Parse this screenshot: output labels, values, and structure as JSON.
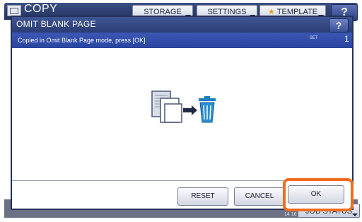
{
  "app": {
    "title": "COPY",
    "tabs": [
      {
        "label": "STORAGE"
      },
      {
        "label": "SETTINGS"
      },
      {
        "label": "TEMPLATE"
      }
    ],
    "help_label": "?",
    "job_status_label": "JOB STATUS",
    "counter_text": "14  16"
  },
  "dialog": {
    "title": "OMIT BLANK PAGE",
    "help_label": "?",
    "message": "Copied in Omit Blank Page mode, press [OK]",
    "set_label": "SET",
    "set_value": "1",
    "buttons": {
      "reset": "RESET",
      "cancel": "CANCEL",
      "ok": "OK"
    }
  },
  "icons": {
    "illustration": "blank-page-to-trash-icon",
    "highlight_color": "#f06d1c"
  }
}
